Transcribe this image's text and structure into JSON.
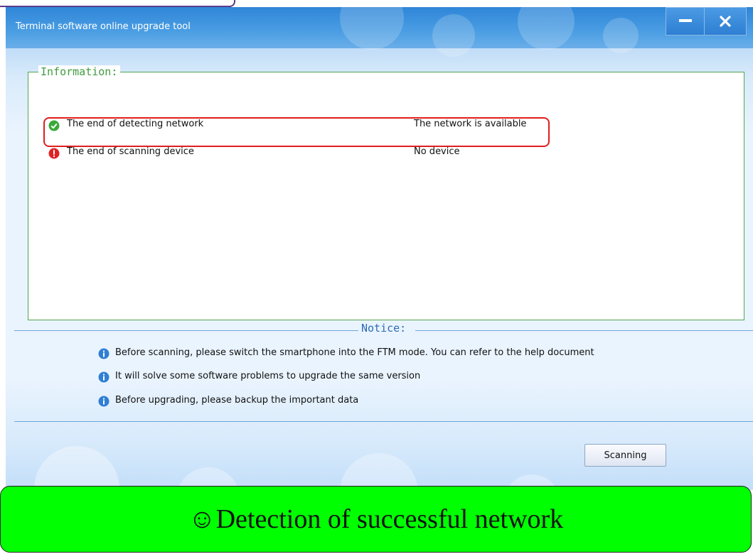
{
  "window": {
    "title": "Terminal software online upgrade tool",
    "minimize_symbol": "—",
    "close_symbol": "✕"
  },
  "information": {
    "legend": "Information:",
    "rows": [
      {
        "icon": "check-circle-icon",
        "label": "The end of detecting network",
        "value": "The network is available",
        "status_color": "#3aa93a"
      },
      {
        "icon": "error-circle-icon",
        "label": "The end of scanning device",
        "value": "No device",
        "status_color": "#e02424"
      }
    ]
  },
  "notice": {
    "legend": "Notice:",
    "items": [
      {
        "icon": "info-circle-icon",
        "text": "Before scanning, please switch the smartphone into the FTM mode. You can refer to the help document"
      },
      {
        "icon": "info-circle-icon",
        "text": "It will solve some software problems to upgrade the same version"
      },
      {
        "icon": "info-circle-icon",
        "text": "Before upgrading, please backup the important data"
      }
    ]
  },
  "actions": {
    "scan_label": "Scanning"
  },
  "caption": {
    "text": "☺Detection of successful network"
  },
  "colors": {
    "titlebar": "#3a8fdc",
    "info_border": "#4ea64e",
    "highlight": "#e01e1e",
    "caption_bg": "#00ff00",
    "info_icon": "#2f7fd3"
  }
}
